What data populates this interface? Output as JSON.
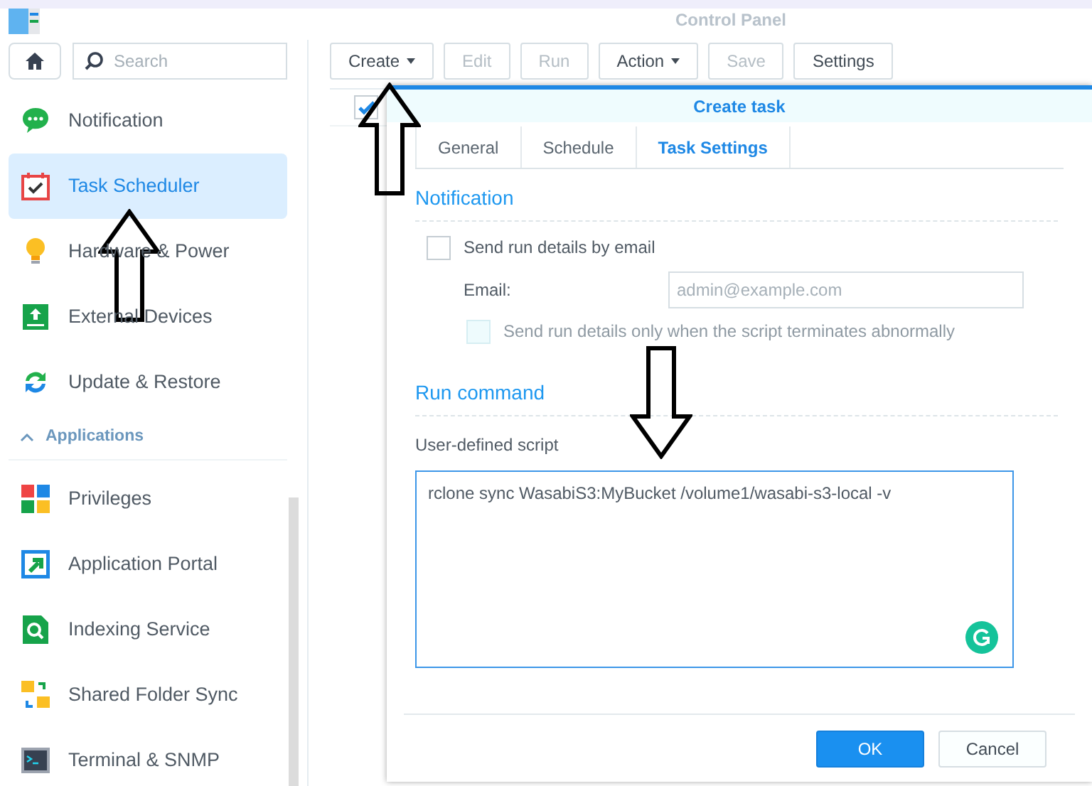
{
  "window": {
    "title": "Control Panel"
  },
  "search": {
    "placeholder": "Search"
  },
  "sidebar": {
    "items": [
      {
        "label": "Notification",
        "kind": "chat",
        "selected": false
      },
      {
        "label": "Task Scheduler",
        "kind": "calendar",
        "selected": true
      },
      {
        "label": "Hardware & Power",
        "kind": "bulb",
        "selected": false
      },
      {
        "label": "External Devices",
        "kind": "upload",
        "selected": false
      },
      {
        "label": "Update & Restore",
        "kind": "refresh",
        "selected": false
      }
    ],
    "section": {
      "label": "Applications",
      "expanded": true
    },
    "app_items": [
      {
        "label": "Privileges",
        "kind": "tiles",
        "selected": false
      },
      {
        "label": "Application Portal",
        "kind": "portal",
        "selected": false
      },
      {
        "label": "Indexing Service",
        "kind": "index",
        "selected": false
      },
      {
        "label": "Shared Folder Sync",
        "kind": "folders",
        "selected": false
      },
      {
        "label": "Terminal & SNMP",
        "kind": "terminal",
        "selected": false
      }
    ]
  },
  "toolbar": [
    {
      "label": "Create",
      "disabled": false,
      "dropdown": true
    },
    {
      "label": "Edit",
      "disabled": true,
      "dropdown": false
    },
    {
      "label": "Run",
      "disabled": true,
      "dropdown": false
    },
    {
      "label": "Action",
      "disabled": false,
      "dropdown": true
    },
    {
      "label": "Save",
      "disabled": true,
      "dropdown": false
    },
    {
      "label": "Settings",
      "disabled": false,
      "dropdown": false
    }
  ],
  "table": {
    "rows": [
      {
        "checked": true
      }
    ]
  },
  "dialog": {
    "title": "Create task",
    "tabs": [
      {
        "label": "General",
        "selected": false
      },
      {
        "label": "Schedule",
        "selected": false
      },
      {
        "label": "Task Settings",
        "selected": true
      }
    ],
    "notification": {
      "title": "Notification",
      "send_email": {
        "label": "Send run details by email",
        "checked": false
      },
      "email_label": "Email:",
      "email_placeholder": "admin@example.com",
      "abnormal_only": {
        "label": "Send run details only when the script terminates abnormally",
        "checked": false,
        "disabled": true
      }
    },
    "run_command": {
      "title": "Run command",
      "script_label": "User-defined script",
      "script": "rclone sync WasabiS3:MyBucket /volume1/wasabi-s3-local -v"
    },
    "buttons": [
      {
        "label": "OK",
        "kind": "primary"
      },
      {
        "label": "Cancel",
        "kind": "secondary"
      }
    ]
  },
  "annotations": [
    {
      "kind": "up"
    },
    {
      "kind": "up"
    },
    {
      "kind": "down"
    }
  ]
}
